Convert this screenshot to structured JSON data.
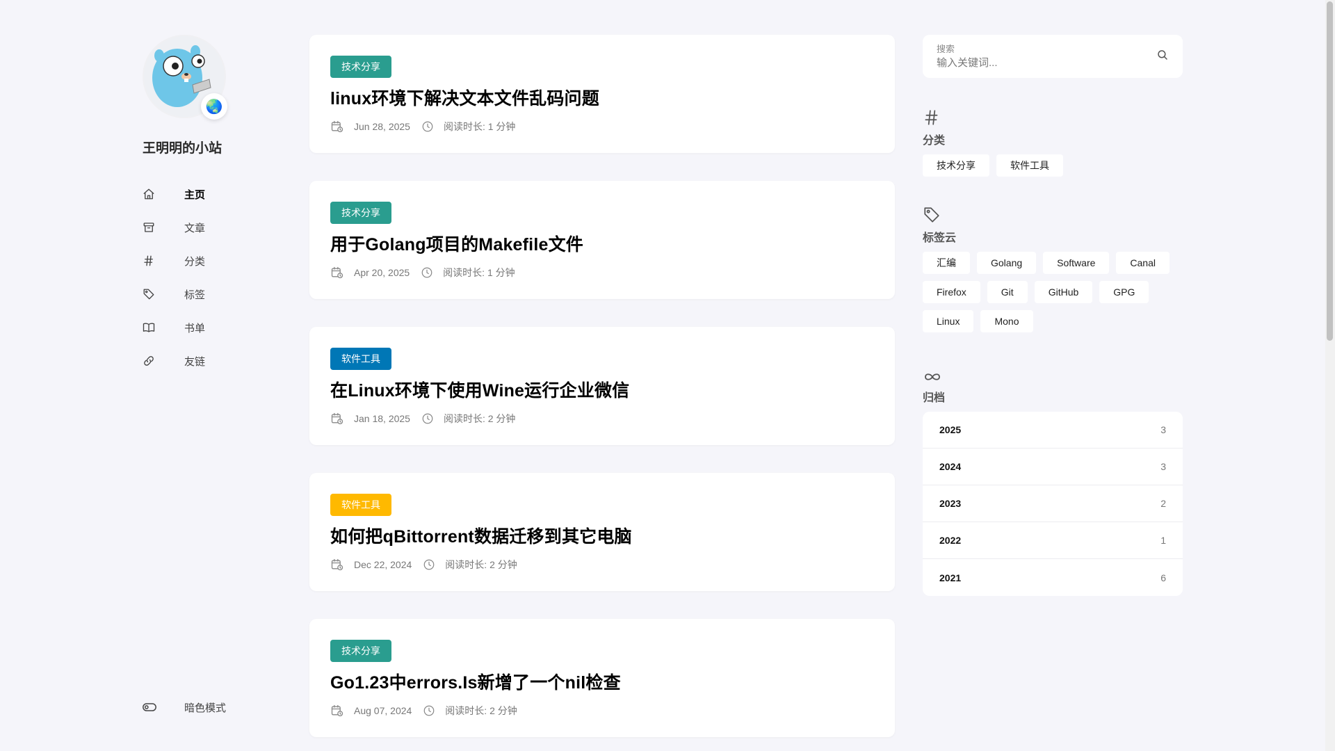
{
  "site": {
    "title": "王明明的小站"
  },
  "nav": {
    "items": [
      {
        "label": "主页",
        "icon": "home-icon",
        "active": true
      },
      {
        "label": "文章",
        "icon": "archive-box-icon"
      },
      {
        "label": "分类",
        "icon": "hash-icon"
      },
      {
        "label": "标签",
        "icon": "tag-icon"
      },
      {
        "label": "书单",
        "icon": "book-icon"
      },
      {
        "label": "友链",
        "icon": "link-icon"
      }
    ],
    "dark_mode_label": "暗色模式"
  },
  "articles": [
    {
      "category": "技术分享",
      "category_color": "#2a9d8f",
      "title": "linux环境下解决文本文件乱码问题",
      "date": "Jun 28, 2025",
      "read_time": "阅读时长: 1 分钟"
    },
    {
      "category": "技术分享",
      "category_color": "#2a9d8f",
      "title": "用于Golang项目的Makefile文件",
      "date": "Apr 20, 2025",
      "read_time": "阅读时长: 1 分钟"
    },
    {
      "category": "软件工具",
      "category_color": "#0077b6",
      "title": "在Linux环境下使用Wine运行企业微信",
      "date": "Jan 18, 2025",
      "read_time": "阅读时长: 2 分钟"
    },
    {
      "category": "软件工具",
      "category_color": "#ffb900",
      "title": "如何把qBittorrent数据迁移到其它电脑",
      "date": "Dec 22, 2024",
      "read_time": "阅读时长: 2 分钟"
    },
    {
      "category": "技术分享",
      "category_color": "#2a9d8f",
      "title": "Go1.23中errors.Is新增了一个nil检查",
      "date": "Aug 07, 2024",
      "read_time": "阅读时长: 2 分钟"
    }
  ],
  "search": {
    "label": "搜索",
    "placeholder": "输入关键词..."
  },
  "categories": {
    "title": "分类",
    "items": [
      "技术分享",
      "软件工具"
    ]
  },
  "tags": {
    "title": "标签云",
    "items": [
      "汇编",
      "Golang",
      "Software",
      "Canal",
      "Firefox",
      "Git",
      "GitHub",
      "GPG",
      "Linux",
      "Mono"
    ]
  },
  "archives": {
    "title": "归档",
    "items": [
      {
        "year": "2025",
        "count": "3"
      },
      {
        "year": "2024",
        "count": "3"
      },
      {
        "year": "2023",
        "count": "2"
      },
      {
        "year": "2022",
        "count": "1"
      },
      {
        "year": "2021",
        "count": "6"
      }
    ]
  },
  "colors": {
    "background": "#f5f5fa",
    "card": "#ffffff"
  }
}
